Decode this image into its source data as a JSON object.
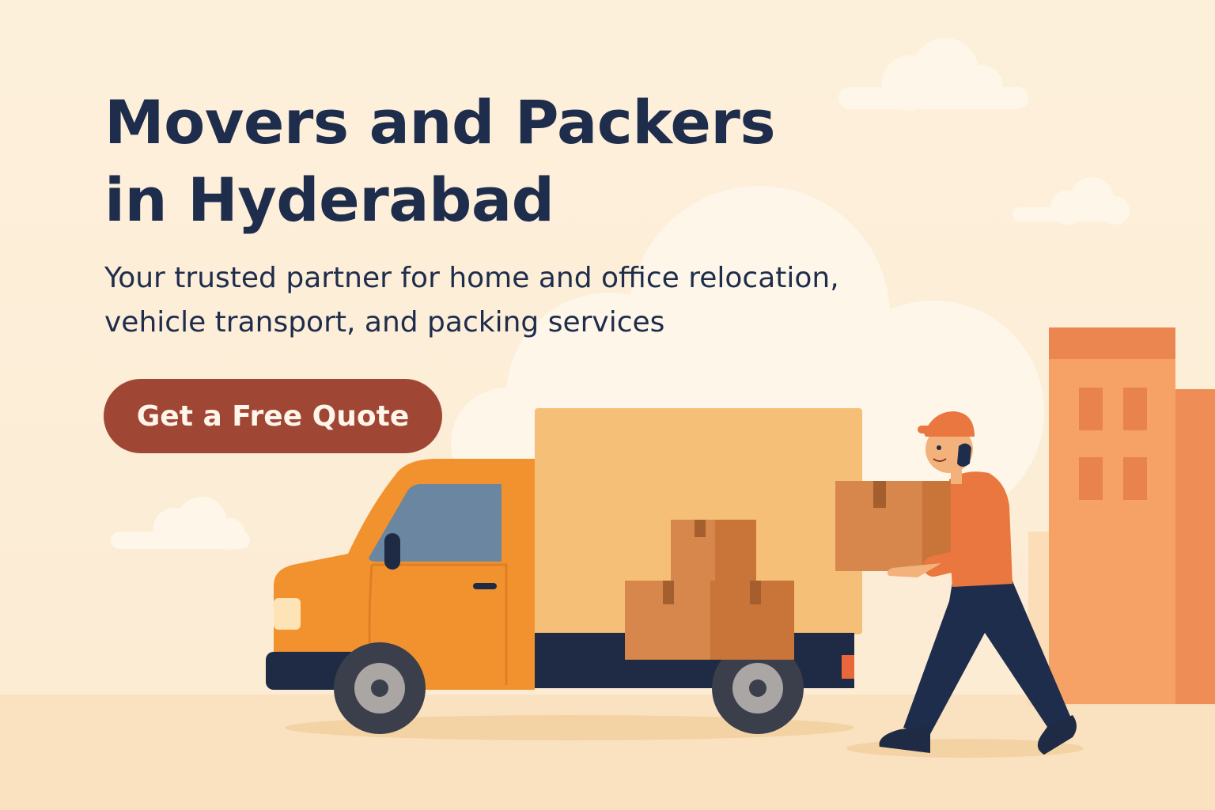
{
  "hero": {
    "title_line1": "Movers and Packers",
    "title_line2": "in Hyderabad",
    "subtitle_line1": "Your trusted partner for home and office relocation,",
    "subtitle_line2": "vehicle transport, and packing services",
    "cta_label": "Get a Free Quote"
  },
  "colors": {
    "background": "#fdf0dc",
    "title": "#1f2d4d",
    "cta_background": "#a04634",
    "truck_body": "#f2922f",
    "cargo_box": "#f6bf78",
    "building": "#ef935a"
  },
  "illustration": {
    "icons": [
      "cloud-icon",
      "truck-icon",
      "cardboard-box-icon",
      "delivery-person-icon",
      "building-icon"
    ]
  }
}
